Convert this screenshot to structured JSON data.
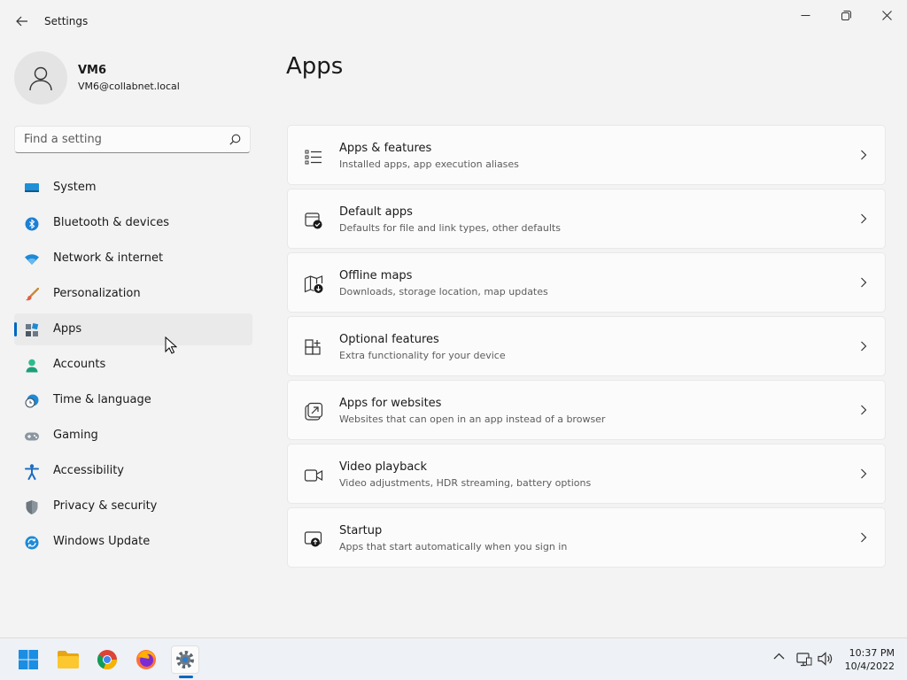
{
  "window": {
    "title": "Settings"
  },
  "user": {
    "name": "VM6",
    "email": "VM6@collabnet.local"
  },
  "search": {
    "placeholder": "Find a setting"
  },
  "sidebar": {
    "items": [
      {
        "label": "System",
        "icon": "system-icon"
      },
      {
        "label": "Bluetooth & devices",
        "icon": "bluetooth-icon"
      },
      {
        "label": "Network & internet",
        "icon": "wifi-icon"
      },
      {
        "label": "Personalization",
        "icon": "brush-icon"
      },
      {
        "label": "Apps",
        "icon": "apps-icon",
        "active": true
      },
      {
        "label": "Accounts",
        "icon": "person-icon"
      },
      {
        "label": "Time & language",
        "icon": "clock-globe-icon"
      },
      {
        "label": "Gaming",
        "icon": "gamepad-icon"
      },
      {
        "label": "Accessibility",
        "icon": "accessibility-icon"
      },
      {
        "label": "Privacy & security",
        "icon": "shield-icon"
      },
      {
        "label": "Windows Update",
        "icon": "update-icon"
      }
    ]
  },
  "main": {
    "title": "Apps",
    "cards": [
      {
        "title": "Apps & features",
        "desc": "Installed apps, app execution aliases",
        "icon": "list-icon"
      },
      {
        "title": "Default apps",
        "desc": "Defaults for file and link types, other defaults",
        "icon": "default-apps-icon"
      },
      {
        "title": "Offline maps",
        "desc": "Downloads, storage location, map updates",
        "icon": "map-download-icon"
      },
      {
        "title": "Optional features",
        "desc": "Extra functionality for your device",
        "icon": "add-grid-icon"
      },
      {
        "title": "Apps for websites",
        "desc": "Websites that can open in an app instead of a browser",
        "icon": "open-link-icon"
      },
      {
        "title": "Video playback",
        "desc": "Video adjustments, HDR streaming, battery options",
        "icon": "video-camera-icon"
      },
      {
        "title": "Startup",
        "desc": "Apps that start automatically when you sign in",
        "icon": "startup-icon"
      }
    ]
  },
  "taskbar": {
    "apps": [
      "start-icon",
      "file-explorer-icon",
      "chrome-icon",
      "firefox-icon",
      "settings-icon"
    ],
    "time": "10:37 PM",
    "date": "10/4/2022"
  },
  "colors": {
    "accent": "#0067c0",
    "background": "#f3f3f3",
    "card": "#fbfbfb"
  }
}
